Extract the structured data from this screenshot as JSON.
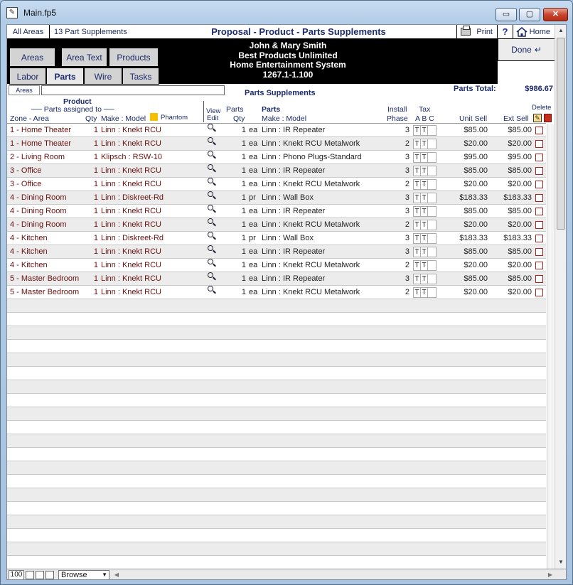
{
  "window": {
    "title": "Main.fp5",
    "min_symbol": "▭",
    "max_symbol": "▢",
    "close_symbol": "✕"
  },
  "topbar": {
    "all_areas": "All Areas",
    "record_count": "13  Part Supplements",
    "title": "Proposal - Product - Parts Supplements",
    "print_label": "Print",
    "help_label": "?",
    "home_label": "Home"
  },
  "nav": {
    "areas": "Areas",
    "area_text": "Area Text",
    "products": "Products",
    "labor": "Labor",
    "parts": "Parts",
    "wire": "Wire",
    "tasks": "Tasks"
  },
  "client": {
    "name": "John & Mary Smith",
    "company": "Best Products Unlimited",
    "system": "Home Entertainment System",
    "ref": "1267.1-1.100"
  },
  "done_label": "Done",
  "filter": {
    "areas_label": "Areas",
    "areas_value": ""
  },
  "section_title": "Parts Supplements",
  "parts_total": {
    "label": "Parts Total:",
    "value": "$986.67"
  },
  "headers": {
    "product": "Product",
    "parts_assigned_to": "Parts assigned to",
    "zone_area": "Zone - Area",
    "qty": "Qty",
    "make_model": "Make : Model",
    "phantom": "Phantom",
    "view": "View",
    "edit": "Edit",
    "parts": "Parts",
    "parts_qty": "Qty",
    "parts_bold": "Parts",
    "parts_make_model": "Make : Model",
    "install": "Install",
    "phase": "Phase",
    "tax": "Tax",
    "abc": "A B C",
    "unit_sell": "Unit Sell",
    "ext_sell": "Ext Sell",
    "delete": "Delete"
  },
  "rows": [
    {
      "zone": "1 - Home Theater",
      "pqty": "1",
      "product": "Linn : Knekt RCU",
      "qty": "1",
      "unit": "ea",
      "part": "Linn : IR Repeater",
      "phase": "3",
      "tax": [
        "T",
        "T",
        ""
      ],
      "unit_sell": "$85.00",
      "ext_sell": "$85.00"
    },
    {
      "zone": "1 - Home Theater",
      "pqty": "1",
      "product": "Linn : Knekt RCU",
      "qty": "1",
      "unit": "ea",
      "part": "Linn : Knekt RCU Metalwork",
      "phase": "2",
      "tax": [
        "T",
        "T",
        ""
      ],
      "unit_sell": "$20.00",
      "ext_sell": "$20.00"
    },
    {
      "zone": "2 - Living Room",
      "pqty": "1",
      "product": "Klipsch : RSW-10",
      "qty": "1",
      "unit": "ea",
      "part": "Linn : Phono Plugs-Standard",
      "phase": "3",
      "tax": [
        "T",
        "T",
        ""
      ],
      "unit_sell": "$95.00",
      "ext_sell": "$95.00"
    },
    {
      "zone": "3 - Office",
      "pqty": "1",
      "product": "Linn : Knekt RCU",
      "qty": "1",
      "unit": "ea",
      "part": "Linn : IR Repeater",
      "phase": "3",
      "tax": [
        "T",
        "T",
        ""
      ],
      "unit_sell": "$85.00",
      "ext_sell": "$85.00"
    },
    {
      "zone": "3 - Office",
      "pqty": "1",
      "product": "Linn : Knekt RCU",
      "qty": "1",
      "unit": "ea",
      "part": "Linn : Knekt RCU Metalwork",
      "phase": "2",
      "tax": [
        "T",
        "T",
        ""
      ],
      "unit_sell": "$20.00",
      "ext_sell": "$20.00"
    },
    {
      "zone": "4 - Dining Room",
      "pqty": "1",
      "product": "Linn : Diskreet-Rd",
      "qty": "1",
      "unit": "pr",
      "part": "Linn : Wall Box",
      "phase": "3",
      "tax": [
        "T",
        "T",
        ""
      ],
      "unit_sell": "$183.33",
      "ext_sell": "$183.33"
    },
    {
      "zone": "4 - Dining Room",
      "pqty": "1",
      "product": "Linn : Knekt RCU",
      "qty": "1",
      "unit": "ea",
      "part": "Linn : IR Repeater",
      "phase": "3",
      "tax": [
        "T",
        "T",
        ""
      ],
      "unit_sell": "$85.00",
      "ext_sell": "$85.00"
    },
    {
      "zone": "4 - Dining Room",
      "pqty": "1",
      "product": "Linn : Knekt RCU",
      "qty": "1",
      "unit": "ea",
      "part": "Linn : Knekt RCU Metalwork",
      "phase": "2",
      "tax": [
        "T",
        "T",
        ""
      ],
      "unit_sell": "$20.00",
      "ext_sell": "$20.00"
    },
    {
      "zone": "4 - Kitchen",
      "pqty": "1",
      "product": "Linn : Diskreet-Rd",
      "qty": "1",
      "unit": "pr",
      "part": "Linn : Wall Box",
      "phase": "3",
      "tax": [
        "T",
        "T",
        ""
      ],
      "unit_sell": "$183.33",
      "ext_sell": "$183.33"
    },
    {
      "zone": "4 - Kitchen",
      "pqty": "1",
      "product": "Linn : Knekt RCU",
      "qty": "1",
      "unit": "ea",
      "part": "Linn : IR Repeater",
      "phase": "3",
      "tax": [
        "T",
        "T",
        ""
      ],
      "unit_sell": "$85.00",
      "ext_sell": "$85.00"
    },
    {
      "zone": "4 - Kitchen",
      "pqty": "1",
      "product": "Linn : Knekt RCU",
      "qty": "1",
      "unit": "ea",
      "part": "Linn : Knekt RCU Metalwork",
      "phase": "2",
      "tax": [
        "T",
        "T",
        ""
      ],
      "unit_sell": "$20.00",
      "ext_sell": "$20.00"
    },
    {
      "zone": "5 - Master Bedroom",
      "pqty": "1",
      "product": "Linn : Knekt RCU",
      "qty": "1",
      "unit": "ea",
      "part": "Linn : IR Repeater",
      "phase": "3",
      "tax": [
        "T",
        "T",
        ""
      ],
      "unit_sell": "$85.00",
      "ext_sell": "$85.00"
    },
    {
      "zone": "5 - Master Bedroom",
      "pqty": "1",
      "product": "Linn : Knekt RCU",
      "qty": "1",
      "unit": "ea",
      "part": "Linn : Knekt RCU Metalwork",
      "phase": "2",
      "tax": [
        "T",
        "T",
        ""
      ],
      "unit_sell": "$20.00",
      "ext_sell": "$20.00"
    }
  ],
  "statusbar": {
    "zoom": "100",
    "mode": "Browse"
  },
  "colors": {
    "header_bar": "#000000",
    "nav_text": "#1b2a6b",
    "zone_text": "#6a1010",
    "phantom": "#f6c000",
    "delete": "#c62b1d"
  }
}
